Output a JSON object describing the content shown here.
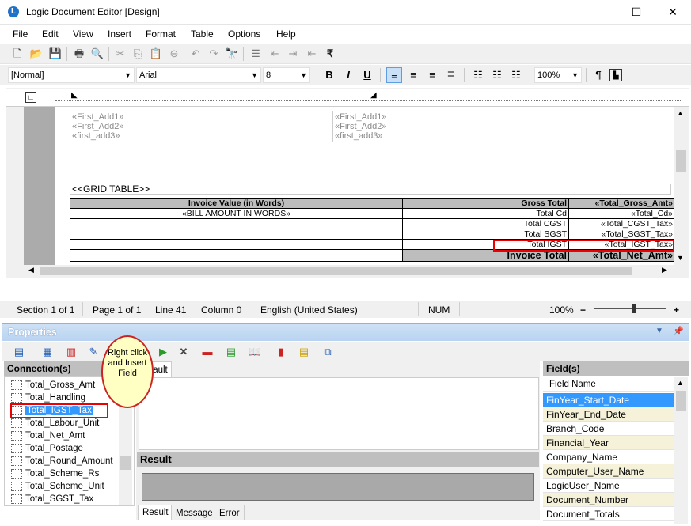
{
  "window": {
    "title": "Logic Document Editor [Design]",
    "controls": [
      "—",
      "☐",
      "✕"
    ]
  },
  "menubar": [
    "File",
    "Edit",
    "View",
    "Insert",
    "Format",
    "Table",
    "Options",
    "Help"
  ],
  "toolbar1": {
    "icons": [
      "new-icon",
      "open-icon",
      "save-icon",
      "print-icon",
      "print-preview-icon",
      "cut-icon",
      "copy-icon",
      "paste-icon",
      "delete-icon",
      "undo-icon",
      "redo-icon",
      "find-icon",
      "align-icon",
      "indent-icon",
      "outdent-icon",
      "indent-left-icon",
      "rupee-icon"
    ],
    "rupee": "₹"
  },
  "toolbar2": {
    "style": "[Normal]",
    "font": "Arial",
    "size": "8",
    "bold": "B",
    "italic": "I",
    "underline": "U",
    "zoom": "100%",
    "pilcrow": "¶"
  },
  "document": {
    "left_fields": [
      "«First_Add1»",
      "«First_Add2»",
      "«first_add3»"
    ],
    "right_fields": [
      "«First_Add1»",
      "«First_Add2»",
      "«first_add3»"
    ],
    "grid_label": "<<GRID TABLE>>",
    "table": {
      "header": [
        "Invoice Value (in Words)",
        "Gross Total",
        "«Total_Gross_Amt»"
      ],
      "rows": [
        [
          "«BILL AMOUNT IN WORDS»",
          "Total Cd",
          "«Total_Cd»"
        ],
        [
          "",
          "Total CGST",
          "«Total_CGST_Tax»"
        ],
        [
          "",
          "Total SGST",
          "«Total_SGST_Tax»"
        ],
        [
          "",
          "Total IGST",
          "«Total_IGST_Tax»"
        ],
        [
          "",
          "Invoice Total",
          "«Total_Net_Amt»"
        ]
      ]
    }
  },
  "statusbar": {
    "section": "Section 1 of 1",
    "page": "Page 1 of 1",
    "line": "Line 41",
    "column": "Column 0",
    "language": "English (United States)",
    "num": "NUM",
    "zoom": "100%",
    "zoom_out": "−",
    "zoom_in": "+",
    "zoom_level": 0.55
  },
  "properties": {
    "title": "Properties",
    "connections_header": "Connection(s)",
    "connections": [
      "Total_Gross_Amt",
      "Total_Handling",
      "Total_IGST_Tax",
      "Total_Labour_Unit",
      "Total_Net_Amt",
      "Total_Postage",
      "Total_Round_Amount",
      "Total_Scheme_Rs",
      "Total_Scheme_Unit",
      "Total_SGST_Tax"
    ],
    "selected_connection": "Total_IGST_Tax",
    "callout": "Right click and Insert Field",
    "tab_label": "fault",
    "result_header": "Result",
    "result_tabs": [
      "Result",
      "Message",
      "Error"
    ],
    "fields_header": "Field(s)",
    "field_name_col": "Field Name",
    "fields": [
      "FinYear_Start_Date",
      "FinYear_End_Date",
      "Branch_Code",
      "Financial_Year",
      "Company_Name",
      "Computer_User_Name",
      "LogicUser_Name",
      "Document_Number",
      "Document_Totals"
    ]
  },
  "colors": {
    "selected": "#3399ff",
    "highlight_row": "#f5f2d9",
    "panel_header": "#bfbfbf"
  }
}
